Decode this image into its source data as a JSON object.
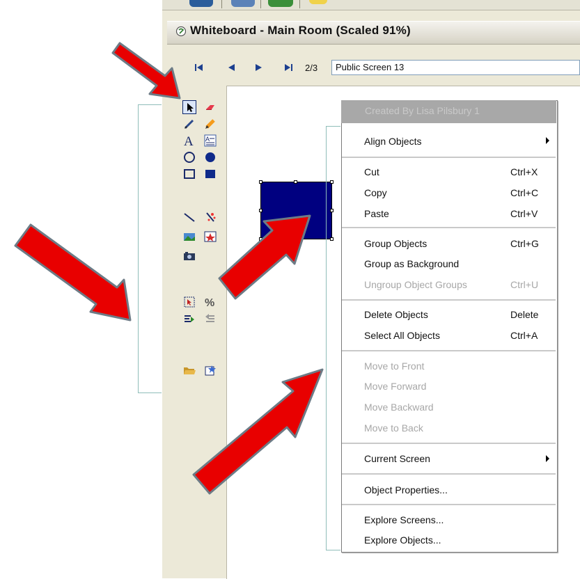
{
  "window": {
    "title": "Whiteboard - Main Room (Scaled 91%)"
  },
  "navigation": {
    "page_indicator": "2/3",
    "screen_name": "Public Screen 13"
  },
  "context_menu": {
    "header": "Created By Lisa Pilsbury 1",
    "items": [
      {
        "label": "Align Objects",
        "shortcut": "",
        "submenu": true,
        "enabled": true
      },
      {
        "label": "Cut",
        "shortcut": "Ctrl+X",
        "enabled": true
      },
      {
        "label": "Copy",
        "shortcut": "Ctrl+C",
        "enabled": true
      },
      {
        "label": "Paste",
        "shortcut": "Ctrl+V",
        "enabled": true
      },
      {
        "label": "Group Objects",
        "shortcut": "Ctrl+G",
        "enabled": true
      },
      {
        "label": "Group as Background",
        "shortcut": "",
        "enabled": true
      },
      {
        "label": "Ungroup Object Groups",
        "shortcut": "Ctrl+U",
        "enabled": false
      },
      {
        "label": "Delete Objects",
        "shortcut": "Delete",
        "enabled": true
      },
      {
        "label": "Select All Objects",
        "shortcut": "Ctrl+A",
        "enabled": true
      },
      {
        "label": "Move to Front",
        "shortcut": "",
        "enabled": false
      },
      {
        "label": "Move Forward",
        "shortcut": "",
        "enabled": false
      },
      {
        "label": "Move Backward",
        "shortcut": "",
        "enabled": false
      },
      {
        "label": "Move to Back",
        "shortcut": "",
        "enabled": false
      },
      {
        "label": "Current Screen",
        "shortcut": "",
        "submenu": true,
        "enabled": true
      },
      {
        "label": "Object Properties...",
        "shortcut": "",
        "enabled": true
      },
      {
        "label": "Explore Screens...",
        "shortcut": "",
        "enabled": true
      },
      {
        "label": "Explore Objects...",
        "shortcut": "",
        "enabled": true
      }
    ]
  },
  "tools": [
    "select-tool",
    "eraser-tool",
    "pen-tool",
    "highlighter-tool",
    "text-tool",
    "text-box-tool",
    "circle-tool",
    "filled-circle-tool",
    "rectangle-tool",
    "filled-rectangle-tool",
    "line-tool",
    "clear-tool",
    "image-tool",
    "clipart-tool",
    "camera-tool",
    "select-area-tool",
    "percent-tool",
    "import-tool",
    "export-tool",
    "open-folder-tool",
    "save-tool"
  ],
  "colors": {
    "shape_fill": "#000080",
    "arrow_fill": "#e80000",
    "arrow_outline": "#6d7b86",
    "menu_header_bg": "#a8a8a8",
    "disabled_text": "#a7a7a7"
  }
}
